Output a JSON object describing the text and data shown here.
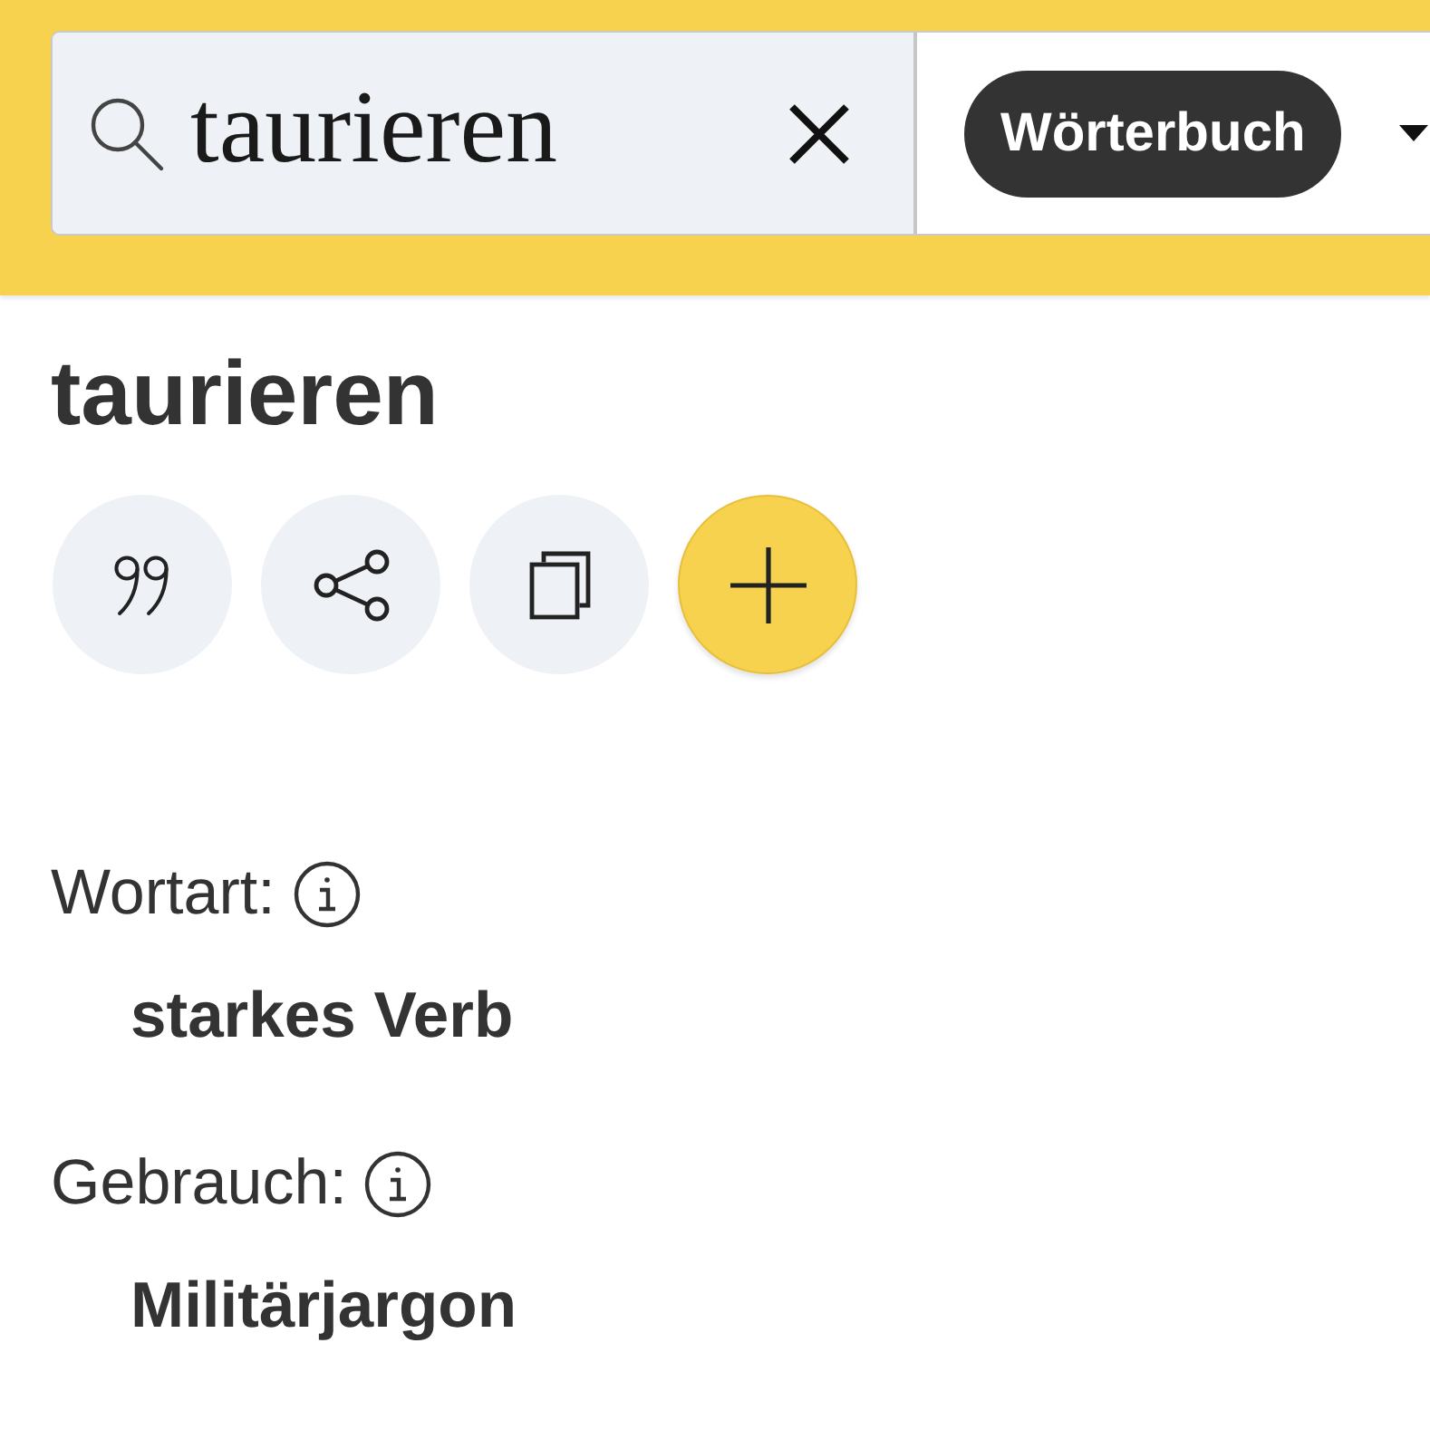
{
  "search": {
    "value": "taurieren"
  },
  "dictionary_button": {
    "label": "Wörterbuch"
  },
  "headword": "taurieren",
  "actions": [
    {
      "kind": "quote"
    },
    {
      "kind": "share"
    },
    {
      "kind": "copy"
    },
    {
      "kind": "add"
    }
  ],
  "details": [
    {
      "label": "Wortart:",
      "value": "starkes Verb"
    },
    {
      "label": "Gebrauch:",
      "value": "Militärjargon"
    }
  ]
}
